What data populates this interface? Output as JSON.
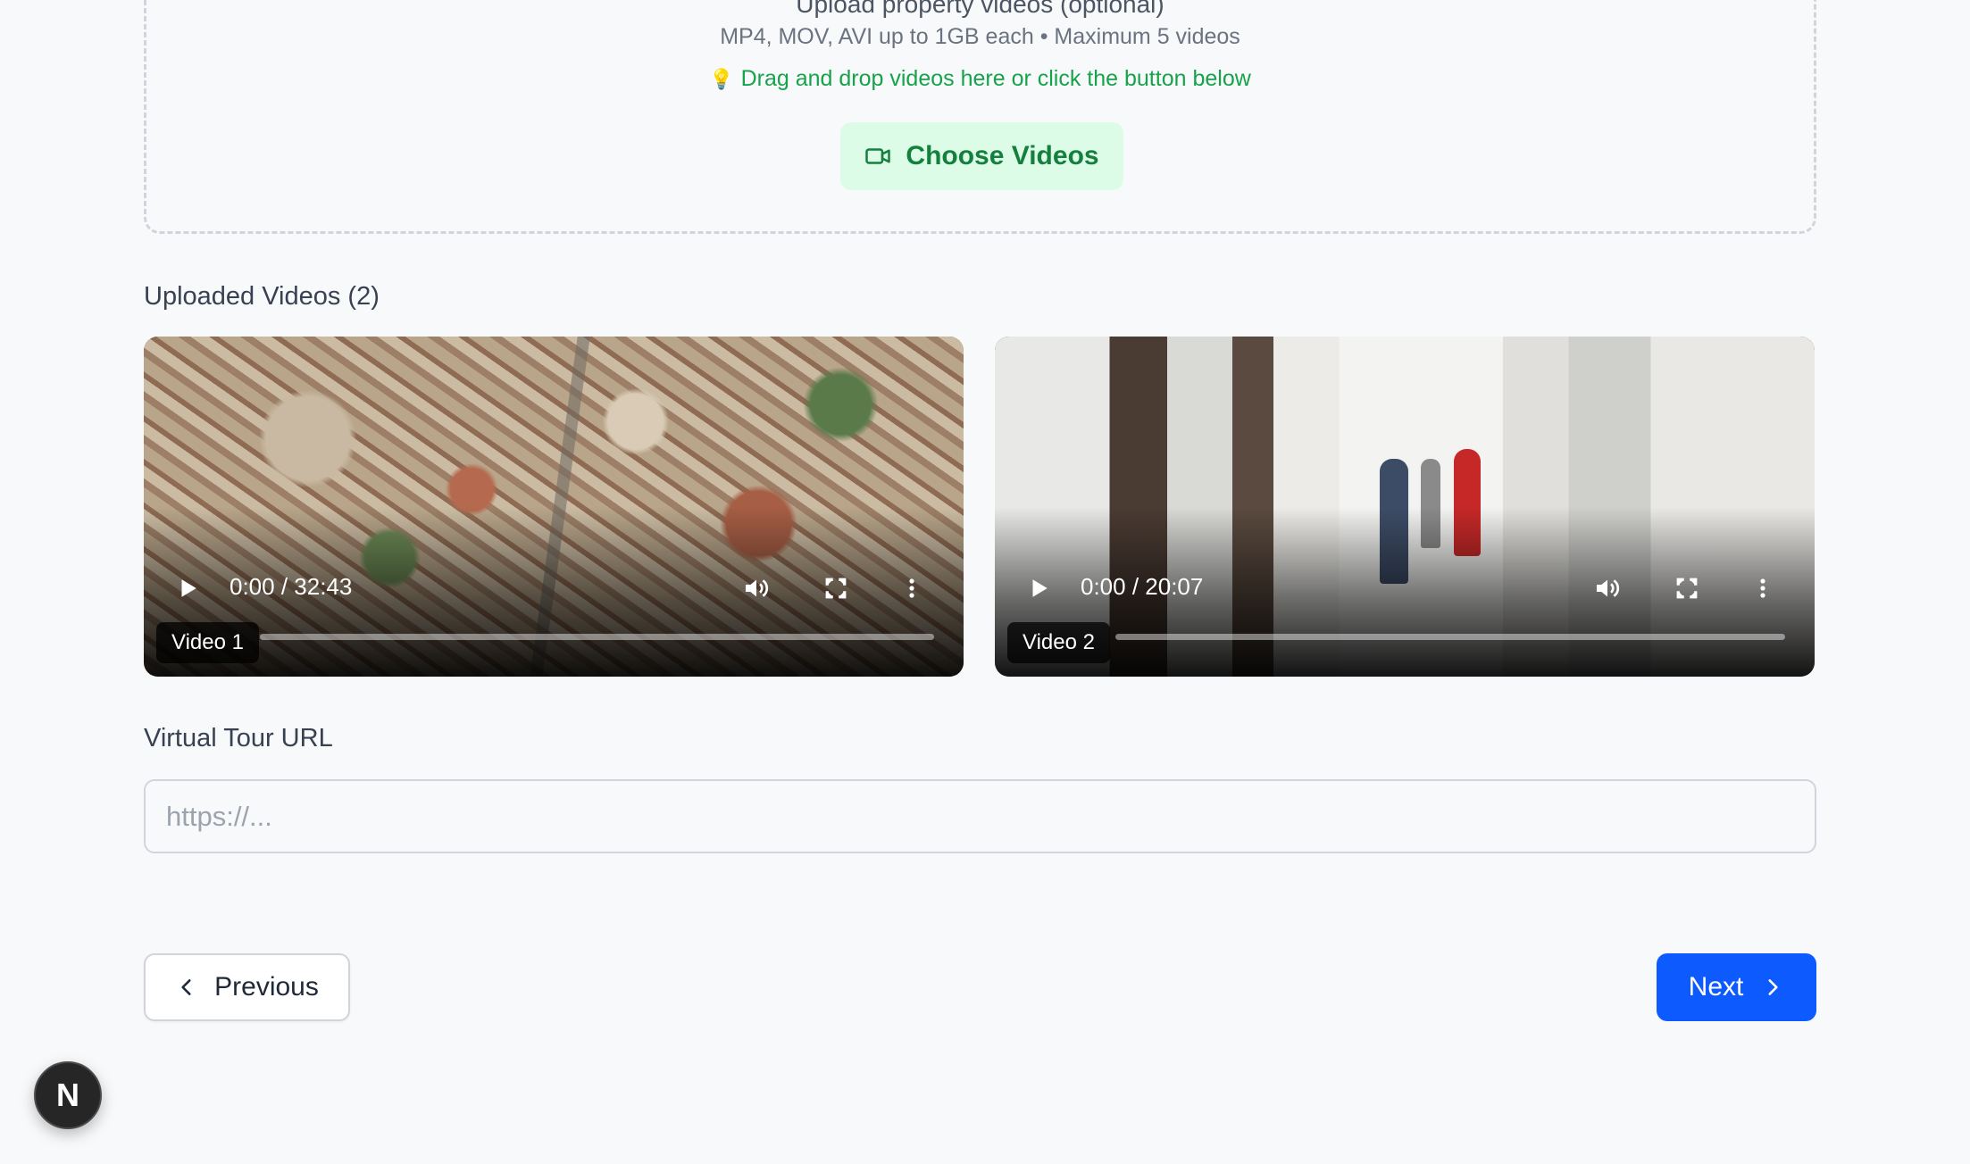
{
  "dropzone": {
    "title": "Upload property videos (optional)",
    "formats": "MP4, MOV, AVI up to 1GB each • Maximum 5 videos",
    "hint_icon": "lightbulb-icon",
    "hint": "Drag and drop videos here or click the button below",
    "choose_button": "Choose Videos",
    "choose_icon": "video-camera-icon"
  },
  "uploaded": {
    "heading": "Uploaded Videos (2)",
    "videos": [
      {
        "label": "Video 1",
        "time": "0:00 / 32:43",
        "progress": 0
      },
      {
        "label": "Video 2",
        "time": "0:00 / 20:07",
        "progress": 0
      }
    ]
  },
  "virtual_tour": {
    "label": "Virtual Tour URL",
    "placeholder": "https://...",
    "value": ""
  },
  "nav": {
    "previous": "Previous",
    "next": "Next"
  },
  "dev_badge": {
    "letter": "N"
  },
  "colors": {
    "accent_blue": "#0d5bff",
    "accent_green": "#16a34a",
    "green_bg": "#dcfce7"
  }
}
